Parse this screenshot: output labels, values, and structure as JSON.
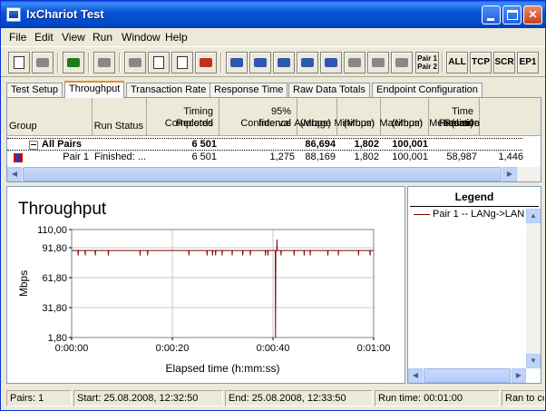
{
  "window": {
    "title": "IxChariot Test"
  },
  "menu": [
    "File",
    "Edit",
    "View",
    "Run",
    "Window",
    "Help"
  ],
  "toolbar": {
    "pair_label_1": "Pair 1",
    "pair_label_2": "Pair 2",
    "all": "ALL",
    "tcp": "TCP",
    "scr": "SCR",
    "ep1": "EP1"
  },
  "tabs": [
    "Test Setup",
    "Throughput",
    "Transaction Rate",
    "Response Time",
    "Raw Data Totals",
    "Endpoint Configuration"
  ],
  "active_tab": "Throughput",
  "table": {
    "headers": {
      "group": "Group",
      "run_status": "Run Status",
      "timing_1": "Timing Records",
      "timing_2": "Completed",
      "ci_1": "95% Confidence",
      "ci_2": "Interval",
      "avg_1": "Average",
      "avg_2": "(Mbps)",
      "min_1": "Minimum",
      "min_2": "(Mbps)",
      "max_1": "Maximum",
      "max_2": "(Mbps)",
      "mt_1": "Measured",
      "mt_2": "Time (sec)",
      "rp_1": "Relative",
      "rp_2": "Precision"
    },
    "all_pairs": {
      "group": "All Pairs",
      "timing": "6 501",
      "average": "86,694",
      "minimum": "1,802",
      "maximum": "100,001"
    },
    "pair1": {
      "group": "Pair 1",
      "status": "Finished: ...",
      "timing": "6 501",
      "ci": "1,275",
      "average": "88,169",
      "minimum": "1,802",
      "maximum": "100,001",
      "measured": "58,987",
      "precision": "1,446"
    }
  },
  "chart_data": {
    "type": "line",
    "title": "Throughput",
    "xlabel": "Elapsed time (h:mm:ss)",
    "ylabel": "Mbps",
    "x_ticks": [
      "0:00:00",
      "0:00:20",
      "0:00:40",
      "0:01:00"
    ],
    "y_ticks": [
      "110,00",
      "91,80",
      "61,80",
      "31,80",
      "1,80"
    ],
    "y_tick_values": [
      110,
      91.8,
      61.8,
      31.8,
      1.8
    ],
    "ylim": [
      1.8,
      110
    ],
    "xlim": [
      0,
      60
    ],
    "grid": true,
    "series": [
      {
        "name": "Pair 1 -- LANg->LAN",
        "color": "#800000",
        "baseline": 89,
        "dips": [
          {
            "t": 1.3,
            "v": 84
          },
          {
            "t": 2.7,
            "v": 84
          },
          {
            "t": 4.7,
            "v": 84
          },
          {
            "t": 7.3,
            "v": 84
          },
          {
            "t": 13.6,
            "v": 84
          },
          {
            "t": 15.1,
            "v": 84
          },
          {
            "t": 23.3,
            "v": 84
          },
          {
            "t": 26.9,
            "v": 84
          },
          {
            "t": 28.0,
            "v": 84
          },
          {
            "t": 28.6,
            "v": 84
          },
          {
            "t": 29.9,
            "v": 84
          },
          {
            "t": 31.9,
            "v": 84
          },
          {
            "t": 34.0,
            "v": 84
          },
          {
            "t": 35.5,
            "v": 84
          },
          {
            "t": 38.5,
            "v": 84
          },
          {
            "t": 39.0,
            "v": 84
          },
          {
            "t": 40.5,
            "v": 1.8
          },
          {
            "t": 40.8,
            "v": 100
          },
          {
            "t": 41.6,
            "v": 84
          },
          {
            "t": 44.2,
            "v": 84
          },
          {
            "t": 46.2,
            "v": 84
          },
          {
            "t": 47.4,
            "v": 84
          },
          {
            "t": 50.9,
            "v": 84
          },
          {
            "t": 53.0,
            "v": 84
          },
          {
            "t": 57.0,
            "v": 84
          },
          {
            "t": 59.3,
            "v": 84
          }
        ]
      }
    ]
  },
  "legend": {
    "title": "Legend",
    "items": [
      "Pair 1 -- LANg->LAN"
    ]
  },
  "status": {
    "pairs": "Pairs: 1",
    "start": "Start: 25.08.2008, 12:32:50",
    "end": "End: 25.08.2008, 12:33:50",
    "runtime": "Run time: 00:01:00",
    "ran": "Ran to co"
  }
}
